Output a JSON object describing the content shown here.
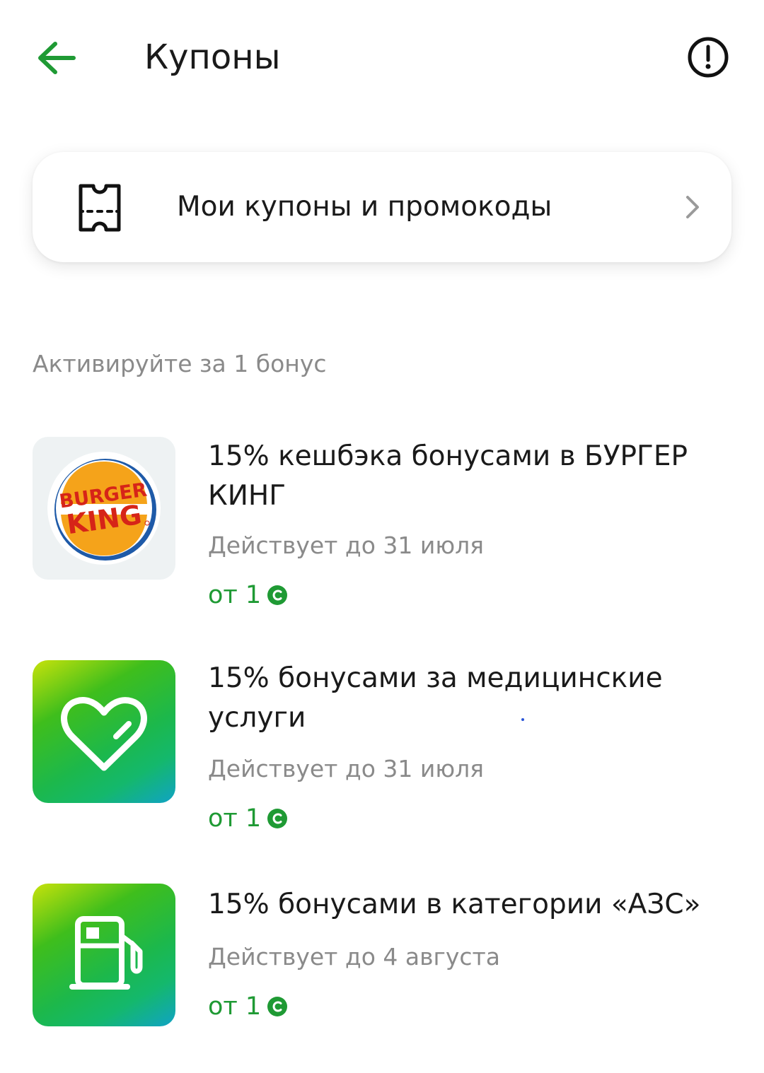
{
  "header": {
    "title": "Купоны",
    "back_icon": "arrow-left-icon",
    "info_icon": "exclamation-circle-icon"
  },
  "my_coupons": {
    "label": "Мои купоны и промокоды",
    "icon": "ticket-icon",
    "chevron": "chevron-right-icon"
  },
  "section": {
    "title": "Активируйте за 1 бонус"
  },
  "offers": [
    {
      "title": "15% кешбэка бонусами в БУРГЕР КИНГ",
      "validity": "Действует до 31 июля",
      "price": "от 1",
      "logo": "burger-king-logo",
      "logo_text_top": "BURGER",
      "logo_text_bottom": "KING"
    },
    {
      "title": "15% бонусами за медицинские услуги",
      "validity": "Действует до 31 июля",
      "price": "от 1",
      "logo": "heart-icon"
    },
    {
      "title": "15% бонусами в категории «АЗС»",
      "validity": "Действует до 4 августа",
      "price": "от 1",
      "logo": "fuel-pump-icon"
    }
  ],
  "colors": {
    "accent_green": "#1f9a34",
    "secondary_text": "#8a8a8a",
    "primary_text": "#1a1a1a"
  }
}
